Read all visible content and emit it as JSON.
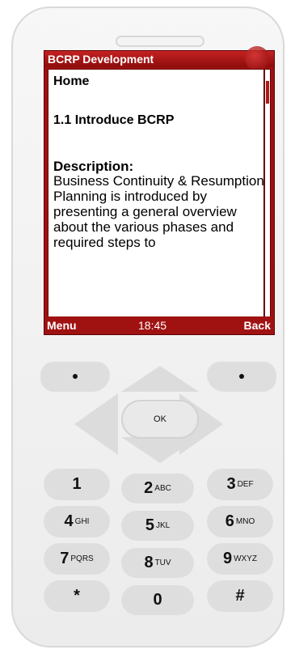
{
  "app": {
    "title": "BCRP Development"
  },
  "content": {
    "home": "Home",
    "section": "1.1  Introduce BCRP",
    "desc_label": "Description:",
    "desc_text": "Business Continuity & Resumption Planning is introduced by presenting a general overview about the various phases and required steps to"
  },
  "softkeys": {
    "left": "Menu",
    "time": "18:45",
    "right": "Back"
  },
  "keypad": {
    "ok": "OK",
    "keys": [
      {
        "num": "1",
        "letters": ""
      },
      {
        "num": "2",
        "letters": "ABC"
      },
      {
        "num": "3",
        "letters": "DEF"
      },
      {
        "num": "4",
        "letters": "GHI"
      },
      {
        "num": "5",
        "letters": "JKL"
      },
      {
        "num": "6",
        "letters": "MNO"
      },
      {
        "num": "7",
        "letters": "PQRS"
      },
      {
        "num": "8",
        "letters": "TUV"
      },
      {
        "num": "9",
        "letters": "WXYZ"
      },
      {
        "num": "*",
        "letters": ""
      },
      {
        "num": "0",
        "letters": ""
      },
      {
        "num": "#",
        "letters": ""
      }
    ]
  },
  "colors": {
    "accent": "#a01212",
    "key_fill": "#dedede"
  }
}
